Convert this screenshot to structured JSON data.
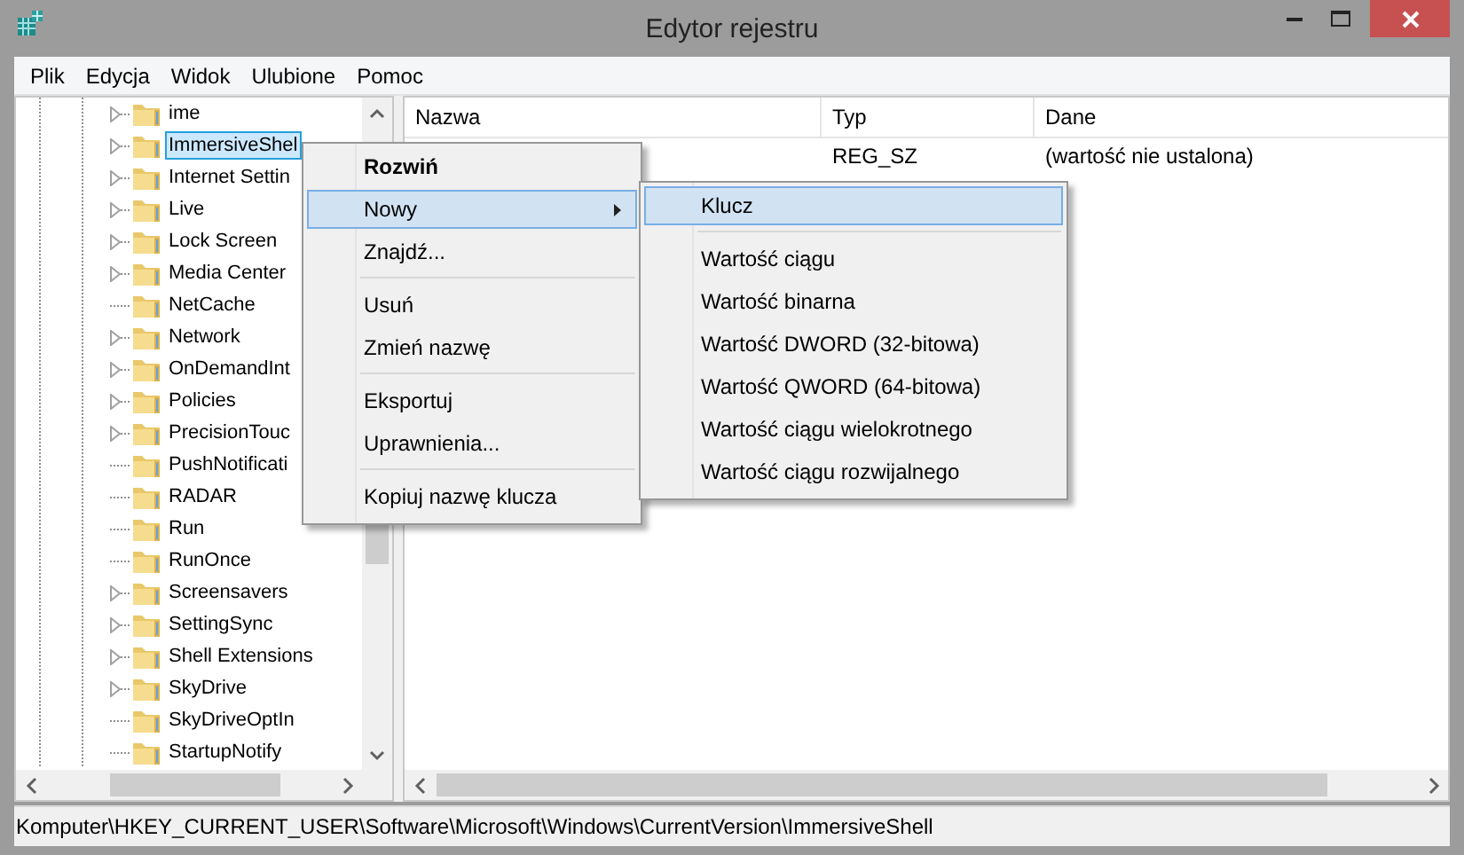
{
  "window": {
    "title": "Edytor rejestru"
  },
  "menu_bar": [
    "Plik",
    "Edycja",
    "Widok",
    "Ulubione",
    "Pomoc"
  ],
  "tree": {
    "items": [
      {
        "label": "ime",
        "kind": "collapsed",
        "selected": false
      },
      {
        "label": "ImmersiveShel",
        "kind": "collapsed",
        "selected": true
      },
      {
        "label": "Internet Settin",
        "kind": "collapsed",
        "selected": false
      },
      {
        "label": "Live",
        "kind": "collapsed",
        "selected": false
      },
      {
        "label": "Lock Screen",
        "kind": "collapsed",
        "selected": false
      },
      {
        "label": "Media Center",
        "kind": "collapsed",
        "selected": false
      },
      {
        "label": "NetCache",
        "kind": "leaf",
        "selected": false
      },
      {
        "label": "Network",
        "kind": "collapsed",
        "selected": false
      },
      {
        "label": "OnDemandInt",
        "kind": "collapsed",
        "selected": false
      },
      {
        "label": "Policies",
        "kind": "collapsed",
        "selected": false
      },
      {
        "label": "PrecisionTouc",
        "kind": "collapsed",
        "selected": false
      },
      {
        "label": "PushNotificati",
        "kind": "leaf",
        "selected": false
      },
      {
        "label": "RADAR",
        "kind": "leaf",
        "selected": false
      },
      {
        "label": "Run",
        "kind": "leaf",
        "selected": false
      },
      {
        "label": "RunOnce",
        "kind": "leaf",
        "selected": false
      },
      {
        "label": "Screensavers",
        "kind": "collapsed",
        "selected": false
      },
      {
        "label": "SettingSync",
        "kind": "collapsed",
        "selected": false
      },
      {
        "label": "Shell Extensions",
        "kind": "collapsed",
        "selected": false
      },
      {
        "label": "SkyDrive",
        "kind": "collapsed",
        "selected": false
      },
      {
        "label": "SkyDriveOptIn",
        "kind": "leaf",
        "selected": false
      },
      {
        "label": "StartupNotify",
        "kind": "leaf",
        "selected": false
      }
    ]
  },
  "values": {
    "columns": [
      "Nazwa",
      "Typ",
      "Dane"
    ],
    "rows": [
      {
        "type": "REG_SZ",
        "data": "(wartość nie ustalona)"
      }
    ]
  },
  "context_menu": {
    "items": [
      {
        "kind": "item",
        "label": "Rozwiń",
        "default": true,
        "highlighted": false,
        "has_submenu": false
      },
      {
        "kind": "item",
        "label": "Nowy",
        "default": false,
        "highlighted": true,
        "has_submenu": true
      },
      {
        "kind": "item",
        "label": "Znajdź...",
        "default": false,
        "highlighted": false,
        "has_submenu": false
      },
      {
        "kind": "separator"
      },
      {
        "kind": "item",
        "label": "Usuń",
        "default": false,
        "highlighted": false,
        "has_submenu": false
      },
      {
        "kind": "item",
        "label": "Zmień nazwę",
        "default": false,
        "highlighted": false,
        "has_submenu": false
      },
      {
        "kind": "separator"
      },
      {
        "kind": "item",
        "label": "Eksportuj",
        "default": false,
        "highlighted": false,
        "has_submenu": false
      },
      {
        "kind": "item",
        "label": "Uprawnienia...",
        "default": false,
        "highlighted": false,
        "has_submenu": false
      },
      {
        "kind": "separator"
      },
      {
        "kind": "item",
        "label": "Kopiuj nazwę klucza",
        "default": false,
        "highlighted": false,
        "has_submenu": false
      }
    ]
  },
  "submenu": {
    "items": [
      {
        "kind": "item",
        "label": "Klucz",
        "default": false,
        "highlighted": true,
        "has_submenu": false
      },
      {
        "kind": "separator"
      },
      {
        "kind": "item",
        "label": "Wartość ciągu",
        "default": false,
        "highlighted": false,
        "has_submenu": false
      },
      {
        "kind": "item",
        "label": "Wartość binarna",
        "default": false,
        "highlighted": false,
        "has_submenu": false
      },
      {
        "kind": "item",
        "label": "Wartość DWORD (32-bitowa)",
        "default": false,
        "highlighted": false,
        "has_submenu": false
      },
      {
        "kind": "item",
        "label": "Wartość QWORD (64-bitowa)",
        "default": false,
        "highlighted": false,
        "has_submenu": false
      },
      {
        "kind": "item",
        "label": "Wartość ciągu wielokrotnego",
        "default": false,
        "highlighted": false,
        "has_submenu": false
      },
      {
        "kind": "item",
        "label": "Wartość ciągu rozwijalnego",
        "default": false,
        "highlighted": false,
        "has_submenu": false
      }
    ]
  },
  "status_bar": "Komputer\\HKEY_CURRENT_USER\\Software\\Microsoft\\Windows\\CurrentVersion\\ImmersiveShell"
}
